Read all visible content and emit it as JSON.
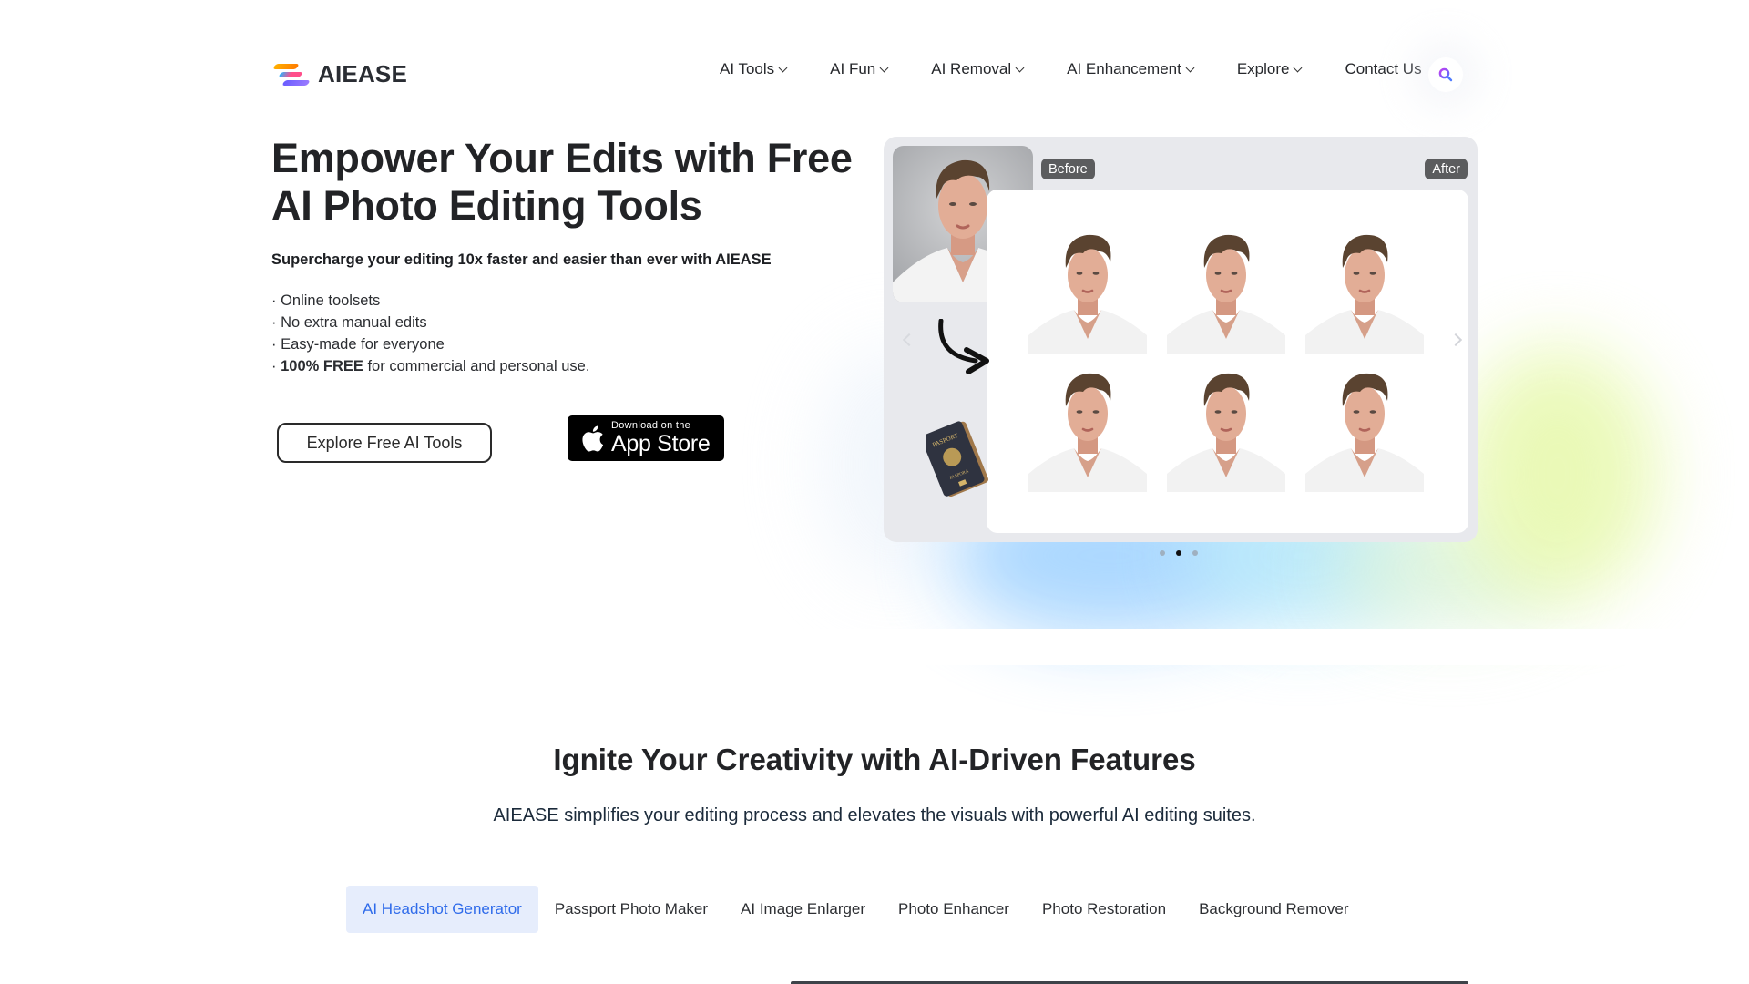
{
  "brand": {
    "name": "AIEASE",
    "logo_icon": "aiease-logo-icon",
    "colors": {
      "accent_blue": "#2f6bea",
      "active_tab_bg": "#e6edfc",
      "badge_bg": "#5b5c5e",
      "carousel_bg": "#e8e9ed"
    }
  },
  "nav": {
    "items": [
      {
        "label": "AI Tools",
        "has_dropdown": true
      },
      {
        "label": "AI Fun",
        "has_dropdown": true
      },
      {
        "label": "AI Removal",
        "has_dropdown": true
      },
      {
        "label": "AI Enhancement",
        "has_dropdown": true
      },
      {
        "label": "Explore",
        "has_dropdown": true
      },
      {
        "label": "Contact Us",
        "has_dropdown": false
      }
    ],
    "search_icon": "search-icon"
  },
  "hero": {
    "title_line1": "Empower Your Edits with Free",
    "title_line2": "AI Photo Editing Tools",
    "subtitle": "Supercharge your editing 10x faster and easier than ever with AIEASE",
    "bullets": [
      {
        "bold": "",
        "text": "· Online toolsets"
      },
      {
        "bold": "",
        "text": "· No extra manual edits"
      },
      {
        "bold": "",
        "text": "· Easy-made for everyone"
      },
      {
        "prefix": "· ",
        "bold": "100% FREE",
        "text": " for commercial and personal use."
      }
    ],
    "explore_button": "Explore Free AI Tools",
    "app_store": {
      "small": "Download on the",
      "big": "App Store"
    }
  },
  "carousel": {
    "before_label": "Before",
    "after_label": "After",
    "result_count": 6,
    "slides_total": 3,
    "active_slide": 2,
    "decor": [
      "curved-arrow-icon",
      "passport-icon"
    ]
  },
  "features": {
    "title": "Ignite Your Creativity with AI-Driven Features",
    "subtitle": "AIEASE simplifies your editing process and elevates the visuals with powerful AI editing suites.",
    "tabs": [
      {
        "label": "AI Headshot Generator",
        "active": true
      },
      {
        "label": "Passport Photo Maker",
        "active": false
      },
      {
        "label": "AI Image Enlarger",
        "active": false
      },
      {
        "label": "Photo Enhancer",
        "active": false
      },
      {
        "label": "Photo Restoration",
        "active": false
      },
      {
        "label": "Background Remover",
        "active": false
      }
    ]
  }
}
